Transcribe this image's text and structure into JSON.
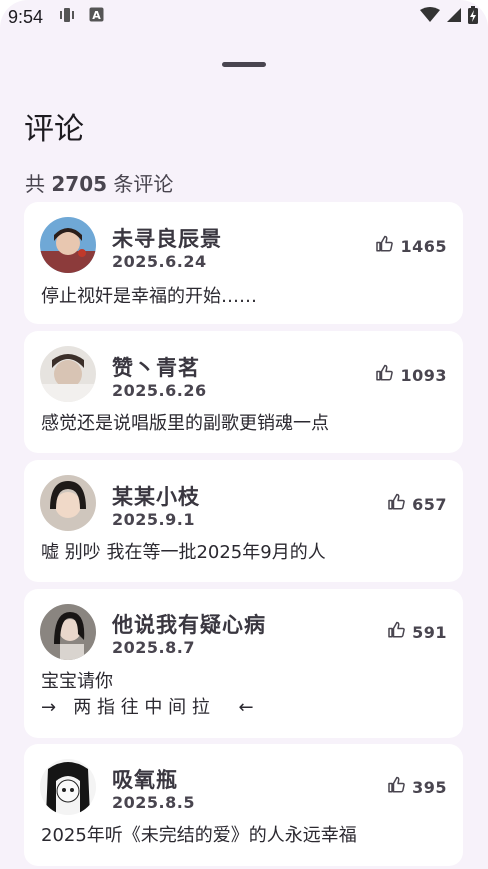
{
  "status_bar": {
    "time": "9:54"
  },
  "sheet": {
    "title": "评论",
    "count_prefix": "共",
    "count_value": "2705",
    "count_suffix": "条评论"
  },
  "comments": [
    {
      "name": "未寻良辰景",
      "date": "2025.6.24",
      "likes": "1465",
      "content": "停止视奸是幸福的开始……"
    },
    {
      "name": "赞丶青茗",
      "date": "2025.6.26",
      "likes": "1093",
      "content": "感觉还是说唱版里的副歌更销魂一点"
    },
    {
      "name": "某某小枝",
      "date": "2025.9.1",
      "likes": "657",
      "content": "嘘 别吵 我在等一批2025年9月的人"
    },
    {
      "name": "他说我有疑心病",
      "date": "2025.8.7",
      "likes": "591",
      "content_line1": "宝宝请你",
      "content_line2": "→   两 指 往 中 间 拉     ←"
    },
    {
      "name": "吸氧瓶",
      "date": "2025.8.5",
      "likes": "395",
      "content": "2025年听《未完结的爱》的人永远幸福"
    }
  ],
  "icons": {
    "like": "thumb-up-outline-icon",
    "wifi": "wifi-icon",
    "signal": "cell-signal-icon",
    "battery": "battery-charging-icon"
  }
}
